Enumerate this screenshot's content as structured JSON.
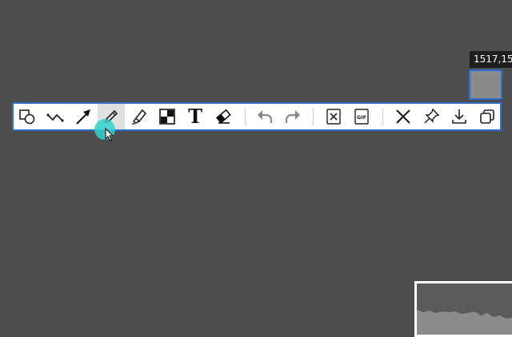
{
  "coordinate_readout": "1517,15",
  "toolbar": {
    "active_tool": "pencil",
    "tools": [
      {
        "name": "shape",
        "icon": "shape-icon"
      },
      {
        "name": "polyline",
        "icon": "polyline-icon"
      },
      {
        "name": "arrow",
        "icon": "arrow-icon"
      },
      {
        "name": "pencil",
        "icon": "pencil-icon"
      },
      {
        "name": "highlighter",
        "icon": "highlighter-icon"
      },
      {
        "name": "mosaic",
        "icon": "mosaic-icon"
      },
      {
        "name": "text",
        "icon": "text-icon",
        "label": "T"
      },
      {
        "name": "eraser",
        "icon": "eraser-icon"
      },
      {
        "name": "undo",
        "icon": "undo-icon"
      },
      {
        "name": "redo",
        "icon": "redo-icon"
      },
      {
        "name": "ocr",
        "icon": "ocr-icon"
      },
      {
        "name": "gif",
        "icon": "gif-icon",
        "label": "GIF"
      },
      {
        "name": "close",
        "icon": "close-icon"
      },
      {
        "name": "pin",
        "icon": "pin-icon"
      },
      {
        "name": "save",
        "icon": "download-icon"
      },
      {
        "name": "copy",
        "icon": "copy-icon"
      }
    ]
  },
  "colors": {
    "background": "#4d4d4d",
    "accent": "#2f6fd0",
    "cursor_halo": "#32d2cd",
    "disabled_icon": "#8a8a8a"
  }
}
